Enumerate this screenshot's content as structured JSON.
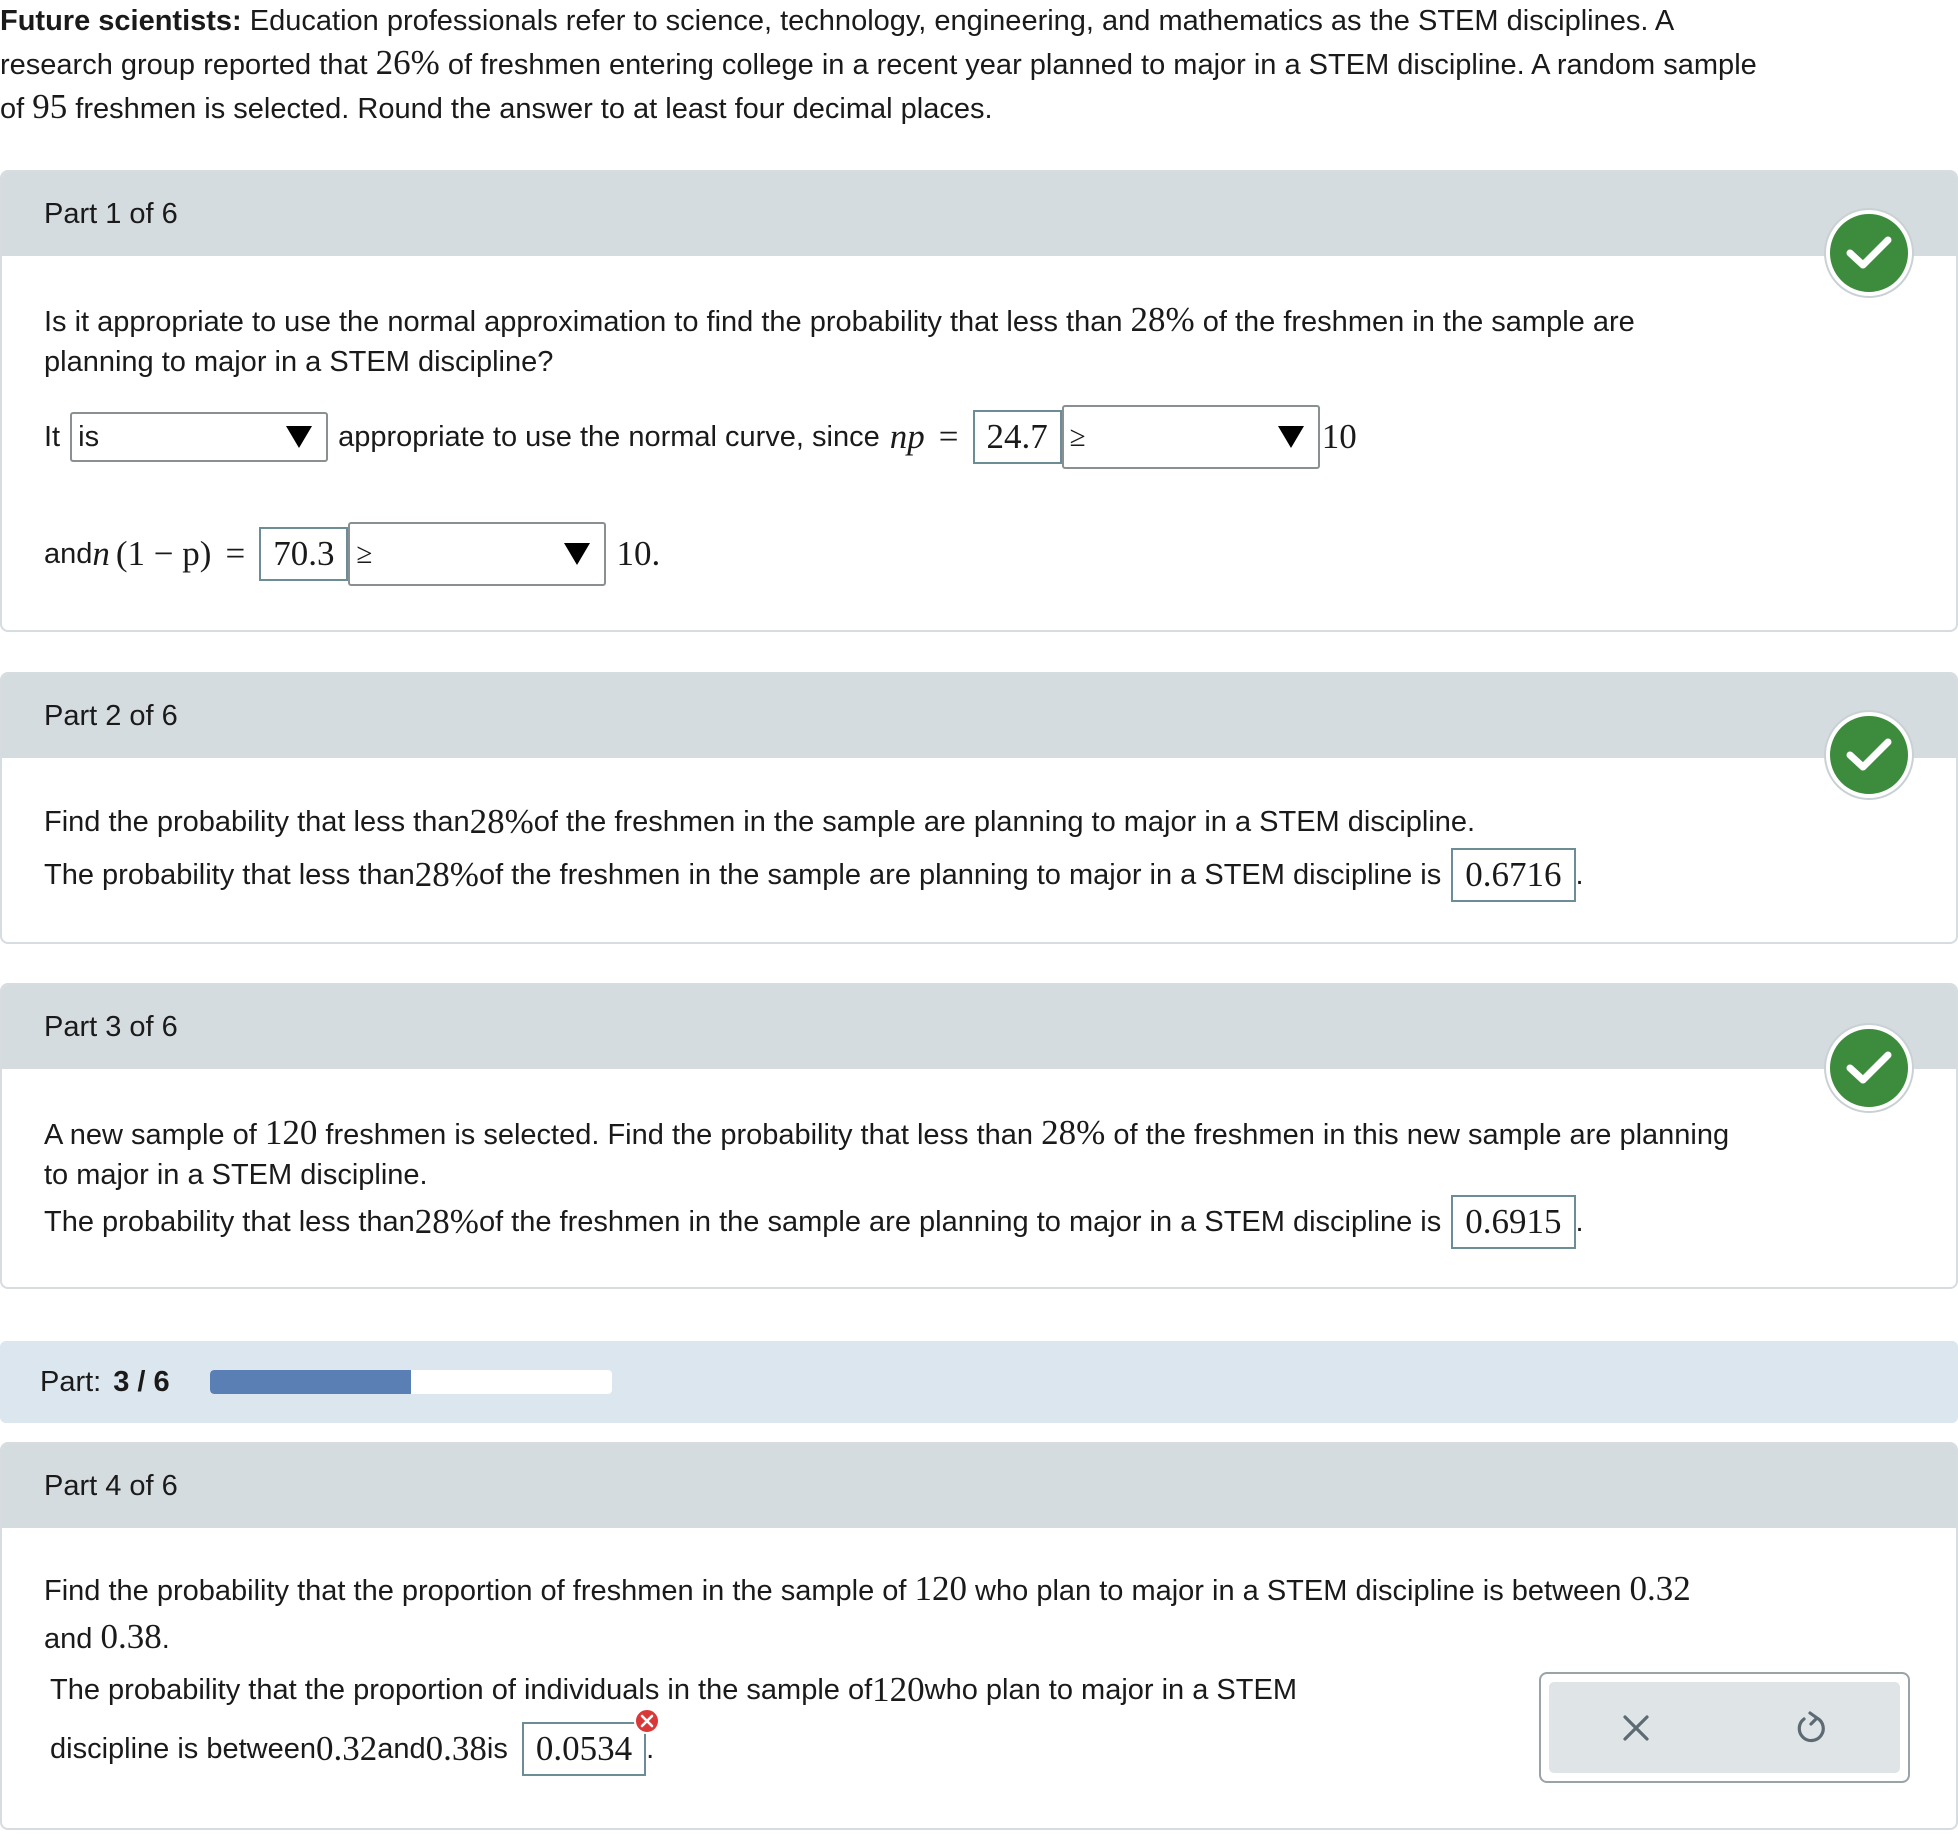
{
  "intro": {
    "bold": "Future scientists:",
    "l1": "Education professionals refer to science, technology, engineering, and mathematics as the STEM disciplines. A",
    "l2a": "research group reported that ",
    "pct": "26%",
    "l2b": " of freshmen entering college in a recent year planned to major in a STEM discipline. A random sample",
    "l3a": "of ",
    "n": "95",
    "l3b": " freshmen is selected. Round the answer to at least four decimal places."
  },
  "part1": {
    "title": "Part 1 of 6",
    "q_a": "Is it appropriate to use the normal approximation to find the probability that less than ",
    "q_pct": "28%",
    "q_b": " of the freshmen in the sample are",
    "q_c": "planning to major in a STEM discipline?",
    "it": "It",
    "sel1": "is",
    "mid": "appropriate to use the normal curve, since",
    "np": "np",
    "eq": "=",
    "np_val": "24.7",
    "sel2": "≥",
    "ten1": "10",
    "and": "and",
    "n_sym": "n",
    "paren": "(1 − p)",
    "eq2": "=",
    "nq_val": "70.3",
    "sel3": "≥",
    "ten2": "10."
  },
  "part2": {
    "title": "Part 2 of 6",
    "q_a": "Find the probability that less than ",
    "q_pct": "28%",
    "q_b": " of the freshmen in the sample are planning to major in a STEM discipline.",
    "a_a": "The probability that less than ",
    "a_pct": "28%",
    "a_b": " of the freshmen in the sample are planning to major in a STEM discipline is",
    "answer": "0.6716",
    "dot": "."
  },
  "part3": {
    "title": "Part 3 of 6",
    "q_a": "A new sample of ",
    "q_n": "120",
    "q_b": " freshmen is selected. Find the probability that less than ",
    "q_pct": "28%",
    "q_c": " of the freshmen in this new sample are planning",
    "q_d": "to major in a STEM discipline.",
    "a_a": "The probability that less than ",
    "a_pct": "28%",
    "a_b": " of the freshmen in the sample are planning to major in a STEM discipline is",
    "answer": "0.6915",
    "dot": "."
  },
  "progress": {
    "label": "Part:",
    "value": "3 / 6",
    "fraction": 0.5,
    "color": "#5a7fb5"
  },
  "part4": {
    "title": "Part 4 of 6",
    "q_a": "Find the probability that the proportion of freshmen in the sample of ",
    "q_n": "120",
    "q_b": " who plan to major in a STEM discipline is between ",
    "q_v1": "0.32",
    "q_and": "and ",
    "q_v2": "0.38",
    "q_dot": ".",
    "a_a": "The probability that the proportion of individuals in the sample of ",
    "a_n": "120",
    "a_b": " who plan to major in a STEM",
    "a_c": "discipline is between ",
    "a_v1": "0.32",
    "a_and": " and ",
    "a_v2": "0.38",
    "a_is": " is",
    "answer": "0.0534",
    "dot": "."
  },
  "icons": {
    "check": "check-icon",
    "error": "error-icon",
    "clear": "close-icon",
    "undo": "undo-icon"
  },
  "colors": {
    "success": "#3d8b3d",
    "error": "#d93838",
    "header": "#d5dcdf"
  }
}
